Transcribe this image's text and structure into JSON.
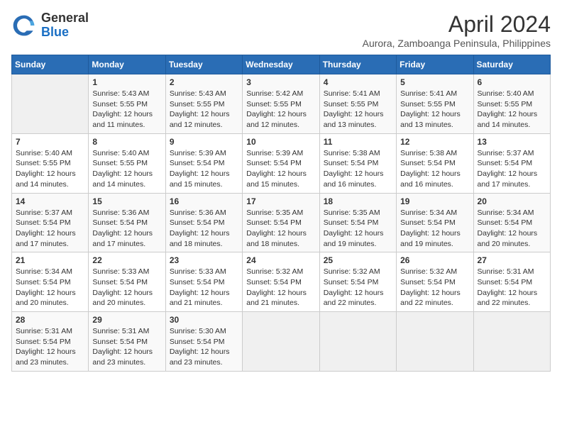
{
  "header": {
    "logo_general": "General",
    "logo_blue": "Blue",
    "month_year": "April 2024",
    "subtitle": "Aurora, Zamboanga Peninsula, Philippines"
  },
  "weekdays": [
    "Sunday",
    "Monday",
    "Tuesday",
    "Wednesday",
    "Thursday",
    "Friday",
    "Saturday"
  ],
  "weeks": [
    [
      {
        "day": "",
        "text": ""
      },
      {
        "day": "1",
        "text": "Sunrise: 5:43 AM\nSunset: 5:55 PM\nDaylight: 12 hours\nand 11 minutes."
      },
      {
        "day": "2",
        "text": "Sunrise: 5:43 AM\nSunset: 5:55 PM\nDaylight: 12 hours\nand 12 minutes."
      },
      {
        "day": "3",
        "text": "Sunrise: 5:42 AM\nSunset: 5:55 PM\nDaylight: 12 hours\nand 12 minutes."
      },
      {
        "day": "4",
        "text": "Sunrise: 5:41 AM\nSunset: 5:55 PM\nDaylight: 12 hours\nand 13 minutes."
      },
      {
        "day": "5",
        "text": "Sunrise: 5:41 AM\nSunset: 5:55 PM\nDaylight: 12 hours\nand 13 minutes."
      },
      {
        "day": "6",
        "text": "Sunrise: 5:40 AM\nSunset: 5:55 PM\nDaylight: 12 hours\nand 14 minutes."
      }
    ],
    [
      {
        "day": "7",
        "text": "Sunrise: 5:40 AM\nSunset: 5:55 PM\nDaylight: 12 hours\nand 14 minutes."
      },
      {
        "day": "8",
        "text": "Sunrise: 5:40 AM\nSunset: 5:55 PM\nDaylight: 12 hours\nand 14 minutes."
      },
      {
        "day": "9",
        "text": "Sunrise: 5:39 AM\nSunset: 5:54 PM\nDaylight: 12 hours\nand 15 minutes."
      },
      {
        "day": "10",
        "text": "Sunrise: 5:39 AM\nSunset: 5:54 PM\nDaylight: 12 hours\nand 15 minutes."
      },
      {
        "day": "11",
        "text": "Sunrise: 5:38 AM\nSunset: 5:54 PM\nDaylight: 12 hours\nand 16 minutes."
      },
      {
        "day": "12",
        "text": "Sunrise: 5:38 AM\nSunset: 5:54 PM\nDaylight: 12 hours\nand 16 minutes."
      },
      {
        "day": "13",
        "text": "Sunrise: 5:37 AM\nSunset: 5:54 PM\nDaylight: 12 hours\nand 17 minutes."
      }
    ],
    [
      {
        "day": "14",
        "text": "Sunrise: 5:37 AM\nSunset: 5:54 PM\nDaylight: 12 hours\nand 17 minutes."
      },
      {
        "day": "15",
        "text": "Sunrise: 5:36 AM\nSunset: 5:54 PM\nDaylight: 12 hours\nand 17 minutes."
      },
      {
        "day": "16",
        "text": "Sunrise: 5:36 AM\nSunset: 5:54 PM\nDaylight: 12 hours\nand 18 minutes."
      },
      {
        "day": "17",
        "text": "Sunrise: 5:35 AM\nSunset: 5:54 PM\nDaylight: 12 hours\nand 18 minutes."
      },
      {
        "day": "18",
        "text": "Sunrise: 5:35 AM\nSunset: 5:54 PM\nDaylight: 12 hours\nand 19 minutes."
      },
      {
        "day": "19",
        "text": "Sunrise: 5:34 AM\nSunset: 5:54 PM\nDaylight: 12 hours\nand 19 minutes."
      },
      {
        "day": "20",
        "text": "Sunrise: 5:34 AM\nSunset: 5:54 PM\nDaylight: 12 hours\nand 20 minutes."
      }
    ],
    [
      {
        "day": "21",
        "text": "Sunrise: 5:34 AM\nSunset: 5:54 PM\nDaylight: 12 hours\nand 20 minutes."
      },
      {
        "day": "22",
        "text": "Sunrise: 5:33 AM\nSunset: 5:54 PM\nDaylight: 12 hours\nand 20 minutes."
      },
      {
        "day": "23",
        "text": "Sunrise: 5:33 AM\nSunset: 5:54 PM\nDaylight: 12 hours\nand 21 minutes."
      },
      {
        "day": "24",
        "text": "Sunrise: 5:32 AM\nSunset: 5:54 PM\nDaylight: 12 hours\nand 21 minutes."
      },
      {
        "day": "25",
        "text": "Sunrise: 5:32 AM\nSunset: 5:54 PM\nDaylight: 12 hours\nand 22 minutes."
      },
      {
        "day": "26",
        "text": "Sunrise: 5:32 AM\nSunset: 5:54 PM\nDaylight: 12 hours\nand 22 minutes."
      },
      {
        "day": "27",
        "text": "Sunrise: 5:31 AM\nSunset: 5:54 PM\nDaylight: 12 hours\nand 22 minutes."
      }
    ],
    [
      {
        "day": "28",
        "text": "Sunrise: 5:31 AM\nSunset: 5:54 PM\nDaylight: 12 hours\nand 23 minutes."
      },
      {
        "day": "29",
        "text": "Sunrise: 5:31 AM\nSunset: 5:54 PM\nDaylight: 12 hours\nand 23 minutes."
      },
      {
        "day": "30",
        "text": "Sunrise: 5:30 AM\nSunset: 5:54 PM\nDaylight: 12 hours\nand 23 minutes."
      },
      {
        "day": "",
        "text": ""
      },
      {
        "day": "",
        "text": ""
      },
      {
        "day": "",
        "text": ""
      },
      {
        "day": "",
        "text": ""
      }
    ]
  ]
}
